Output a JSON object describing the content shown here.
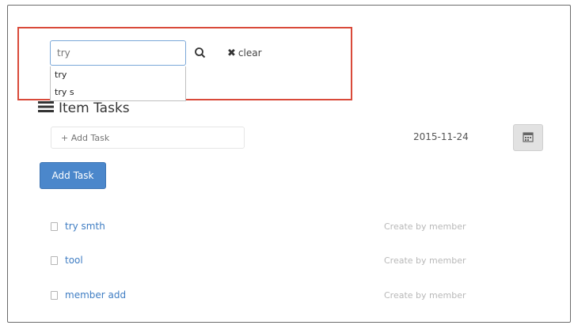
{
  "search": {
    "value": "try",
    "clear_label": "clear",
    "suggestions": [
      "try",
      "try s"
    ]
  },
  "section": {
    "title": "Item Tasks"
  },
  "new_task": {
    "placeholder": "+ Add Task",
    "date": "2015-11-24",
    "add_button_label": "Add Task"
  },
  "tasks": [
    {
      "name": "try smth",
      "meta": "Create by member"
    },
    {
      "name": "tool",
      "meta": "Create by member"
    },
    {
      "name": "member add",
      "meta": "Create by member"
    }
  ],
  "colors": {
    "highlight": "#d94a3a",
    "primary_button": "#4b87cb",
    "task_link": "#3f7dc3"
  },
  "icons": [
    "search-icon",
    "close-icon",
    "list-icon",
    "calendar-icon",
    "checkbox-icon"
  ]
}
